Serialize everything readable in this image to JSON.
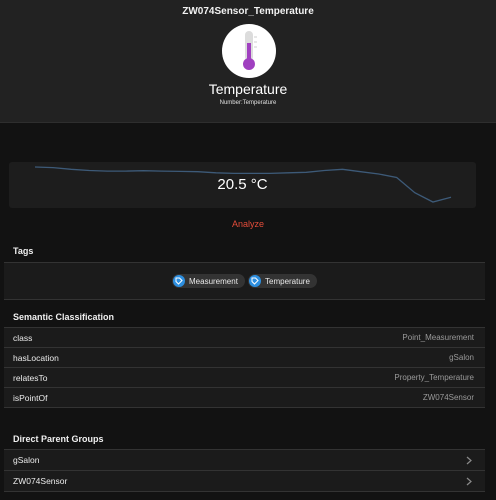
{
  "header": {
    "title": "ZW074Sensor_Temperature",
    "icon": "thermometer-icon",
    "icon_color": "#a040c0",
    "label": "Temperature",
    "type": "Number:Temperature"
  },
  "chart": {
    "value": "20.5 °C",
    "line_color": "#3d5a78",
    "series": [
      0.0,
      -0.05,
      -0.2,
      -0.3,
      -0.35,
      -0.35,
      -0.32,
      -0.35,
      -0.38,
      -0.4,
      -0.5,
      -0.55,
      -0.55,
      -0.55,
      -0.5,
      -0.45,
      -0.3,
      -0.2,
      -0.4,
      -0.6,
      -0.9,
      -2.2,
      -3.0,
      -2.6
    ]
  },
  "analyze": {
    "label": "Analyze",
    "color": "#e34c3a"
  },
  "tags": {
    "title": "Tags",
    "items": [
      {
        "label": "Measurement",
        "icon": "tag-icon"
      },
      {
        "label": "Temperature",
        "icon": "tag-icon"
      }
    ]
  },
  "semantic": {
    "title": "Semantic Classification",
    "rows": [
      {
        "label": "class",
        "value": "Point_Measurement"
      },
      {
        "label": "hasLocation",
        "value": "gSalon"
      },
      {
        "label": "relatesTo",
        "value": "Property_Temperature"
      },
      {
        "label": "isPointOf",
        "value": "ZW074Sensor"
      }
    ]
  },
  "parents": {
    "title": "Direct Parent Groups",
    "items": [
      {
        "label": "gSalon",
        "icon": "chevron-right-icon"
      },
      {
        "label": "ZW074Sensor",
        "icon": "chevron-right-icon"
      }
    ]
  }
}
